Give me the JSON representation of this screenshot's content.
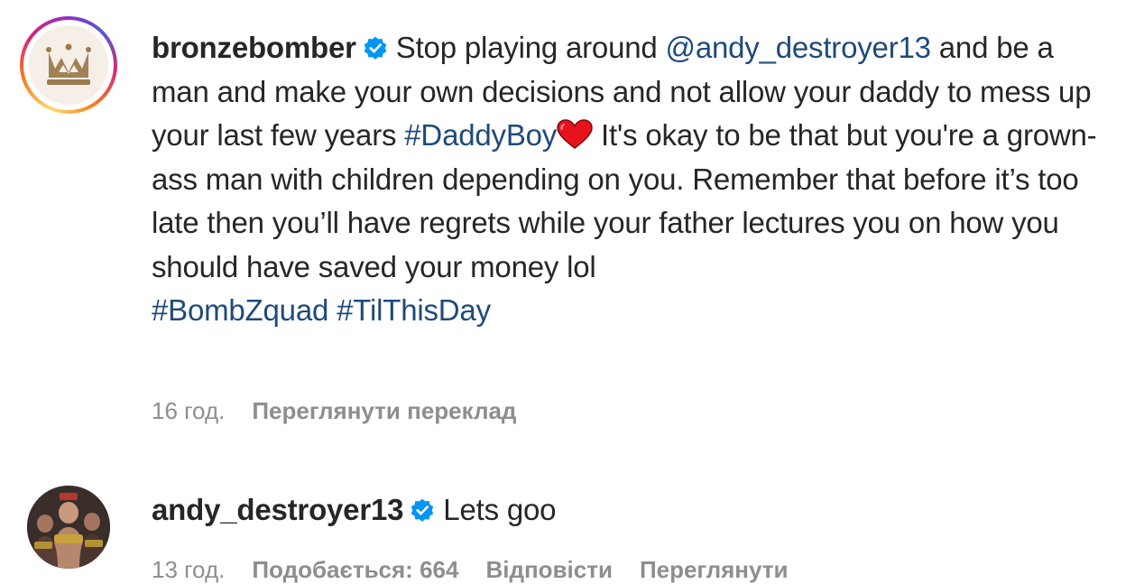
{
  "comments": [
    {
      "username": "bronzebomber",
      "verified": true,
      "text_part1": "Stop playing around ",
      "mention": "@andy_destroyer13",
      "text_part2": " and be a man and make your own decisions and not allow your daddy to mess up your last few years ",
      "hashtag_inline": "#DaddyBoy",
      "emoji": "heart",
      "text_part3": " It's okay to be that but you're a grown-ass man with children depending on you. Remember that before it’s too late then you’ll have regrets while your father lectures you on how you should have saved your money lol",
      "hashtags": [
        "#BombZquad",
        "#TilThisDay"
      ],
      "time": "16 год.",
      "translate_label": "Переглянути переклад"
    },
    {
      "username": "andy_destroyer13",
      "verified": true,
      "text": "Lets goo",
      "time": "13 год.",
      "likes_label": "Подобається: 664",
      "reply_label": "Відповісти",
      "translate_label": "Переглянути"
    }
  ],
  "colors": {
    "text": "#262626",
    "link": "#00376b",
    "meta": "#8e8e8e",
    "verified": "#0095f6",
    "heart": "#e8111e"
  }
}
